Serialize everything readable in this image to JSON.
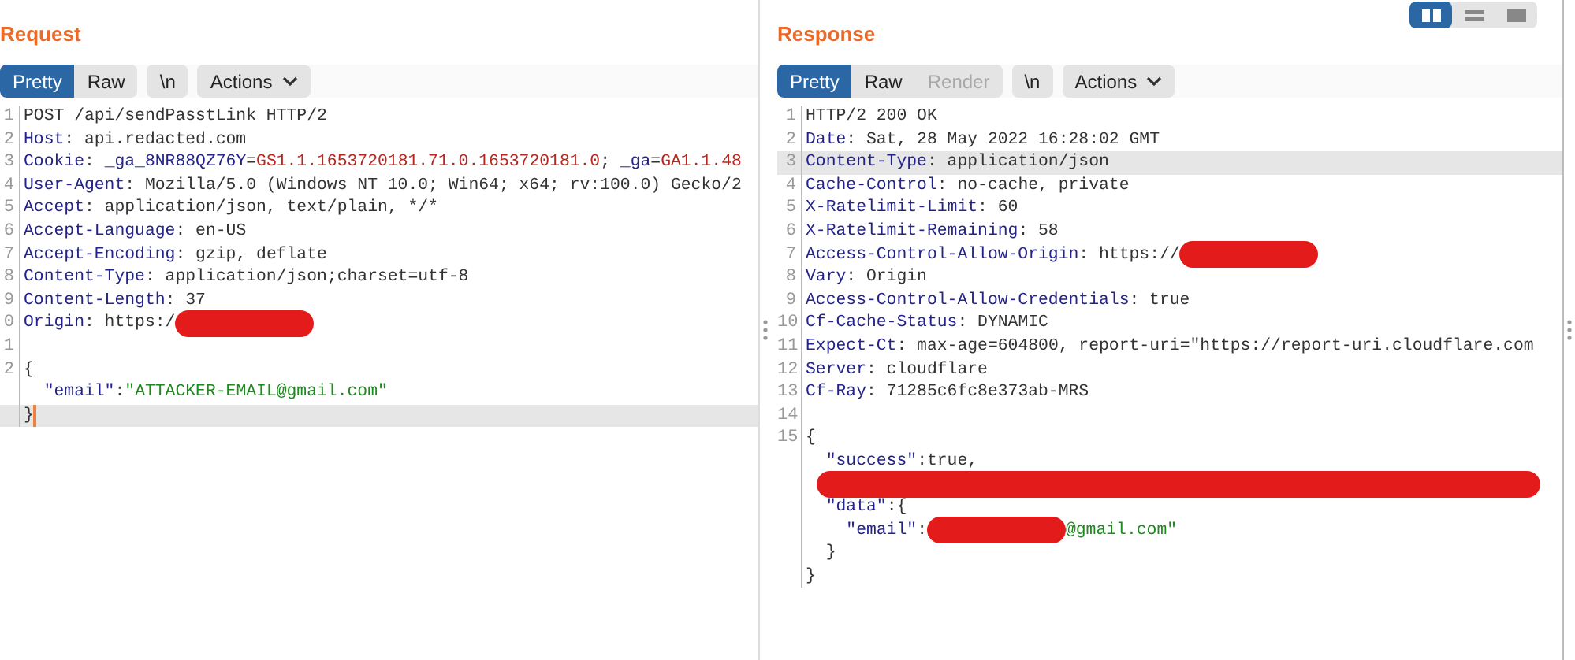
{
  "layout_toggle": [
    {
      "kind": "side-by-side",
      "selected": true
    },
    {
      "kind": "stacked",
      "selected": false
    },
    {
      "kind": "single",
      "selected": false
    }
  ],
  "panes": [
    {
      "title": "Request",
      "view_tabs": [
        {
          "label": "Pretty",
          "selected": true,
          "disabled": false
        },
        {
          "label": "Raw",
          "selected": false,
          "disabled": false
        }
      ],
      "newline_toggle": "\\n",
      "actions": "Actions",
      "lines": [
        {
          "number": "1",
          "highlighted": false,
          "cursor": false,
          "segments": [
            {
              "kind": "plain",
              "text": "POST /api/sendPasstLink HTTP/2"
            }
          ]
        },
        {
          "number": "2",
          "highlighted": false,
          "cursor": false,
          "segments": [
            {
              "kind": "key",
              "text": "Host"
            },
            {
              "kind": "plain",
              "text": ": api.redacted.com"
            }
          ]
        },
        {
          "number": "3",
          "highlighted": false,
          "cursor": false,
          "segments": [
            {
              "kind": "key",
              "text": "Cookie"
            },
            {
              "kind": "plain",
              "text": ": "
            },
            {
              "kind": "key",
              "text": "_ga_8NR88QZ76Y"
            },
            {
              "kind": "plain",
              "text": "="
            },
            {
              "kind": "value",
              "text": "GS1.1.1653720181.71.0.1653720181.0"
            },
            {
              "kind": "plain",
              "text": "; "
            },
            {
              "kind": "key",
              "text": "_ga"
            },
            {
              "kind": "plain",
              "text": "="
            },
            {
              "kind": "value",
              "text": "GA1.1.48"
            }
          ]
        },
        {
          "number": "4",
          "highlighted": false,
          "cursor": false,
          "segments": [
            {
              "kind": "key",
              "text": "User-Agent"
            },
            {
              "kind": "plain",
              "text": ": Mozilla/5.0 (Windows NT 10.0; Win64; x64; rv:100.0) Gecko/2"
            }
          ]
        },
        {
          "number": "5",
          "highlighted": false,
          "cursor": false,
          "segments": [
            {
              "kind": "key",
              "text": "Accept"
            },
            {
              "kind": "plain",
              "text": ": application/json, text/plain, */*"
            }
          ]
        },
        {
          "number": "6",
          "highlighted": false,
          "cursor": false,
          "segments": [
            {
              "kind": "key",
              "text": "Accept-Language"
            },
            {
              "kind": "plain",
              "text": ": en-US"
            }
          ]
        },
        {
          "number": "7",
          "highlighted": false,
          "cursor": false,
          "segments": [
            {
              "kind": "key",
              "text": "Accept-Encoding"
            },
            {
              "kind": "plain",
              "text": ": gzip, deflate"
            }
          ]
        },
        {
          "number": "8",
          "highlighted": false,
          "cursor": false,
          "segments": [
            {
              "kind": "key",
              "text": "Content-Type"
            },
            {
              "kind": "plain",
              "text": ": application/json;charset=utf-8"
            }
          ]
        },
        {
          "number": "9",
          "highlighted": false,
          "cursor": false,
          "segments": [
            {
              "kind": "key",
              "text": "Content-Length"
            },
            {
              "kind": "plain",
              "text": ": 37"
            }
          ]
        },
        {
          "number": "0",
          "highlighted": false,
          "cursor": false,
          "segments": [
            {
              "kind": "key",
              "text": "Origin"
            },
            {
              "kind": "plain",
              "text": ": https:/"
            },
            {
              "kind": "redacted"
            }
          ]
        },
        {
          "number": "1",
          "highlighted": false,
          "cursor": false
        },
        {
          "number": "2",
          "highlighted": false,
          "cursor": false,
          "segments": [
            {
              "kind": "plain",
              "text": "{"
            }
          ]
        },
        {
          "highlighted": false,
          "cursor": false,
          "segments": [
            {
              "kind": "key",
              "text": "  \"email\""
            },
            {
              "kind": "plain",
              "text": ":"
            },
            {
              "kind": "string",
              "text": "\"ATTACKER-EMAIL@gmail.com\""
            }
          ]
        },
        {
          "highlighted": true,
          "cursor": true,
          "segments": [
            {
              "kind": "plain",
              "text": "}"
            }
          ]
        }
      ]
    },
    {
      "title": "Response",
      "view_tabs": [
        {
          "label": "Pretty",
          "selected": true,
          "disabled": false
        },
        {
          "label": "Raw",
          "selected": false,
          "disabled": false
        },
        {
          "label": "Render",
          "selected": false,
          "disabled": true
        }
      ],
      "newline_toggle": "\\n",
      "actions": "Actions",
      "lines": [
        {
          "number": "1",
          "highlighted": false,
          "cursor": false,
          "segments": [
            {
              "kind": "plain",
              "text": "HTTP/2 200 OK"
            }
          ]
        },
        {
          "number": "2",
          "highlighted": false,
          "cursor": false,
          "segments": [
            {
              "kind": "key",
              "text": "Date"
            },
            {
              "kind": "plain",
              "text": ": Sat, 28 May 2022 16:28:02 GMT"
            }
          ]
        },
        {
          "number": "3",
          "highlighted": true,
          "cursor": false,
          "segments": [
            {
              "kind": "key",
              "text": "Content-Type"
            },
            {
              "kind": "plain",
              "text": ": application/json"
            }
          ]
        },
        {
          "number": "4",
          "highlighted": false,
          "cursor": false,
          "segments": [
            {
              "kind": "key",
              "text": "Cache-Control"
            },
            {
              "kind": "plain",
              "text": ": no-cache, private"
            }
          ]
        },
        {
          "number": "5",
          "highlighted": false,
          "cursor": false,
          "segments": [
            {
              "kind": "key",
              "text": "X-Ratelimit-Limit"
            },
            {
              "kind": "plain",
              "text": ": 60"
            }
          ]
        },
        {
          "number": "6",
          "highlighted": false,
          "cursor": false,
          "segments": [
            {
              "kind": "key",
              "text": "X-Ratelimit-Remaining"
            },
            {
              "kind": "plain",
              "text": ": 58"
            }
          ]
        },
        {
          "number": "7",
          "highlighted": false,
          "cursor": false,
          "segments": [
            {
              "kind": "key",
              "text": "Access-Control-Allow-Origin"
            },
            {
              "kind": "plain",
              "text": ": https://"
            },
            {
              "kind": "redacted"
            }
          ]
        },
        {
          "number": "8",
          "highlighted": false,
          "cursor": false,
          "segments": [
            {
              "kind": "key",
              "text": "Vary"
            },
            {
              "kind": "plain",
              "text": ": Origin"
            }
          ]
        },
        {
          "number": "9",
          "highlighted": false,
          "cursor": false,
          "segments": [
            {
              "kind": "key",
              "text": "Access-Control-Allow-Credentials"
            },
            {
              "kind": "plain",
              "text": ": true"
            }
          ]
        },
        {
          "number": "10",
          "highlighted": false,
          "cursor": false,
          "segments": [
            {
              "kind": "key",
              "text": "Cf-Cache-Status"
            },
            {
              "kind": "plain",
              "text": ": DYNAMIC"
            }
          ]
        },
        {
          "number": "11",
          "highlighted": false,
          "cursor": false,
          "segments": [
            {
              "kind": "key",
              "text": "Expect-Ct"
            },
            {
              "kind": "plain",
              "text": ": max-age=604800, report-uri=\"https://report-uri.cloudflare.com"
            }
          ]
        },
        {
          "number": "12",
          "highlighted": false,
          "cursor": false,
          "segments": [
            {
              "kind": "key",
              "text": "Server"
            },
            {
              "kind": "plain",
              "text": ": cloudflare"
            }
          ]
        },
        {
          "number": "13",
          "highlighted": false,
          "cursor": false,
          "segments": [
            {
              "kind": "key",
              "text": "Cf-Ray"
            },
            {
              "kind": "plain",
              "text": ": 71285c6fc8e373ab-MRS"
            }
          ]
        },
        {
          "number": "14",
          "highlighted": false,
          "cursor": false
        },
        {
          "number": "15",
          "highlighted": false,
          "cursor": false,
          "segments": [
            {
              "kind": "plain",
              "text": "{"
            }
          ]
        },
        {
          "highlighted": false,
          "cursor": false,
          "segments": [
            {
              "kind": "key",
              "text": "  \"success\""
            },
            {
              "kind": "plain",
              "text": ":true,"
            }
          ]
        },
        {
          "highlighted": false,
          "cursor": false,
          "segments": [
            {
              "kind": "redacted-line"
            }
          ]
        },
        {
          "highlighted": false,
          "cursor": false,
          "segments": [
            {
              "kind": "key",
              "text": "  \"data\""
            },
            {
              "kind": "plain",
              "text": ":{"
            }
          ]
        },
        {
          "highlighted": false,
          "cursor": false,
          "segments": [
            {
              "kind": "key",
              "text": "    \"email\""
            },
            {
              "kind": "plain",
              "text": ":"
            },
            {
              "kind": "redacted"
            },
            {
              "kind": "string",
              "text": "@gmail.com\""
            }
          ]
        },
        {
          "highlighted": false,
          "cursor": false,
          "segments": [
            {
              "kind": "plain",
              "text": "  }"
            }
          ]
        },
        {
          "highlighted": false,
          "cursor": false,
          "segments": [
            {
              "kind": "plain",
              "text": "}"
            }
          ]
        }
      ]
    }
  ]
}
